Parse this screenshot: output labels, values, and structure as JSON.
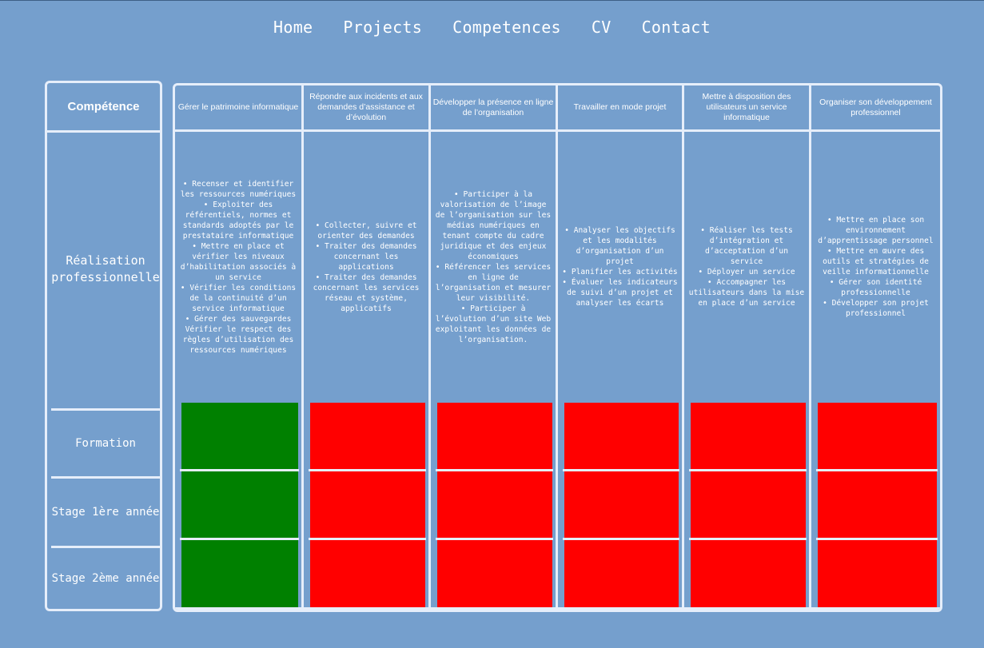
{
  "nav": {
    "items": [
      "Home",
      "Projects",
      "Competences",
      "CV",
      "Contact"
    ]
  },
  "left": {
    "header": "Compétence",
    "realisation": "Réalisation professionnelle",
    "formation": "Formation",
    "stage1": "Stage 1ère année",
    "stage2": "Stage 2ème année"
  },
  "colors": {
    "background": "#759fcd",
    "border": "#e6eefa",
    "acquired": "#008000",
    "not_acquired": "#ff0000"
  },
  "columns": [
    {
      "title": "Gérer le patrimoine informatique",
      "body": "• Recenser et identifier les ressources numériques\n• Exploiter des référentiels, normes et standards adoptés par le prestataire informatique\n• Mettre en place et vérifier les niveaux d’habilitation associés à un service\n• Vérifier les conditions de la continuité d’un service informatique\n• Gérer des sauvegardes Vérifier le respect des règles d’utilisation des ressources numériques",
      "status": [
        "acquired",
        "acquired",
        "acquired"
      ]
    },
    {
      "title": "Répondre aux incidents et aux demandes d’assistance et d’évolution",
      "body": "• Collecter, suivre et orienter des demandes\n• Traiter des demandes concernant les applications\n• Traiter des demandes concernant les services réseau et système, applicatifs",
      "status": [
        "not_acquired",
        "not_acquired",
        "not_acquired"
      ]
    },
    {
      "title": "Développer la présence en ligne de l’organisation",
      "body": "• Participer à la valorisation de l’image de l’organisation sur les médias numériques en tenant compte du cadre juridique et des enjeux économiques\n• Référencer les services en ligne de l’organisation et mesurer leur visibilité.\n• Participer à l’évolution d’un site Web exploitant les données de l’organisation.",
      "status": [
        "not_acquired",
        "not_acquired",
        "not_acquired"
      ]
    },
    {
      "title": "Travailler en mode projet",
      "body": "• Analyser les objectifs et les modalités d’organisation d’un projet\n• Planifier les activités\n• Évaluer les indicateurs de suivi d’un projet et analyser les écarts",
      "status": [
        "not_acquired",
        "not_acquired",
        "not_acquired"
      ]
    },
    {
      "title": "Mettre à disposition des utilisateurs un service informatique",
      "body": "• Réaliser les tests d’intégration et d’acceptation d’un service\n• Déployer un service\n• Accompagner les utilisateurs dans la mise en place d’un service",
      "status": [
        "not_acquired",
        "not_acquired",
        "not_acquired"
      ]
    },
    {
      "title": "Organiser son développement professionnel",
      "body": "• Mettre en place son environnement d’apprentissage personnel\n• Mettre en œuvre des outils et stratégies de veille informationnelle\n• Gérer son identité professionnelle\n• Développer son projet professionnel",
      "status": [
        "not_acquired",
        "not_acquired",
        "not_acquired"
      ]
    }
  ]
}
